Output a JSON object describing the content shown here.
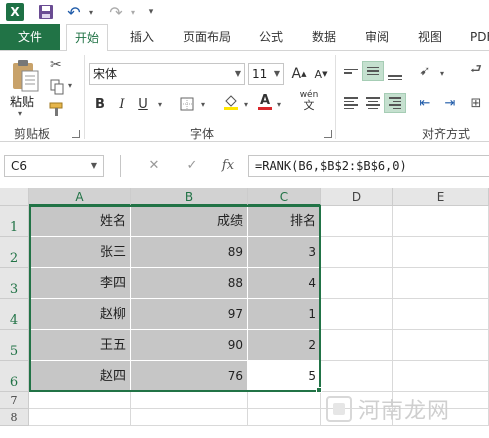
{
  "app": {
    "logo_text": "X"
  },
  "tabs": [
    "文件",
    "开始",
    "插入",
    "页面布局",
    "公式",
    "数据",
    "审阅",
    "视图",
    "PDF"
  ],
  "ribbon": {
    "clipboard": {
      "paste_label": "粘贴",
      "group_label": "剪贴板"
    },
    "font": {
      "font_name": "宋体",
      "font_size": "11",
      "grow_label": "A",
      "shrink_label": "A",
      "bold": "B",
      "italic": "I",
      "underline": "U",
      "wen_label": "wén",
      "group_label": "字体",
      "font_color": "#d9262b",
      "fill_color": "#ffe600"
    },
    "alignment": {
      "group_label": "对齐方式"
    }
  },
  "formula_bar": {
    "name_box": "C6",
    "cancel": "✕",
    "enter": "✓",
    "fx": "fx",
    "formula": "=RANK(B6,$B$2:$B$6,0)"
  },
  "sheet": {
    "columns": [
      "A",
      "B",
      "C",
      "D",
      "E"
    ],
    "rows": [
      "1",
      "2",
      "3",
      "4",
      "5",
      "6",
      "7",
      "8"
    ],
    "header": [
      "姓名",
      "成绩",
      "排名"
    ],
    "data": [
      [
        "张三",
        "89",
        "3"
      ],
      [
        "李四",
        "88",
        "4"
      ],
      [
        "赵柳",
        "97",
        "1"
      ],
      [
        "王五",
        "90",
        "2"
      ],
      [
        "赵四",
        "76",
        "5"
      ]
    ]
  },
  "watermark": "河南龙网",
  "colors": {
    "accent": "#217346",
    "selection": "#c6c6c6"
  }
}
